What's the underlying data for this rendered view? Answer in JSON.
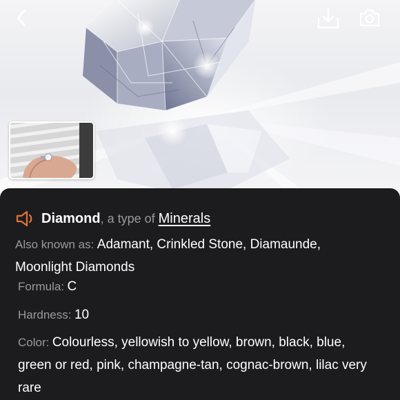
{
  "header": {
    "back_icon": "chevron-left-icon",
    "download_icon": "download-icon",
    "camera_icon": "camera-icon"
  },
  "thumbnail": {
    "icon": "ring-photo"
  },
  "identification": {
    "speaker_icon": "speaker-icon",
    "accent_color": "#e8733a",
    "name": "Diamond",
    "type_prefix": ", a type of",
    "type_link": "Minerals"
  },
  "details": {
    "aka_label": "Also known as:",
    "aka_value": "Adamant, Crinkled Stone, Diamaunde, Moonlight Diamonds",
    "formula_label": "Formula:",
    "formula_value": "C",
    "hardness_label": "Hardness:",
    "hardness_value": "10",
    "color_label": "Color:",
    "color_value": "Colourless, yellowish to yellow, brown, black, blue, green or red, pink, champagne-tan, cognac-brown, lilac very rare"
  }
}
